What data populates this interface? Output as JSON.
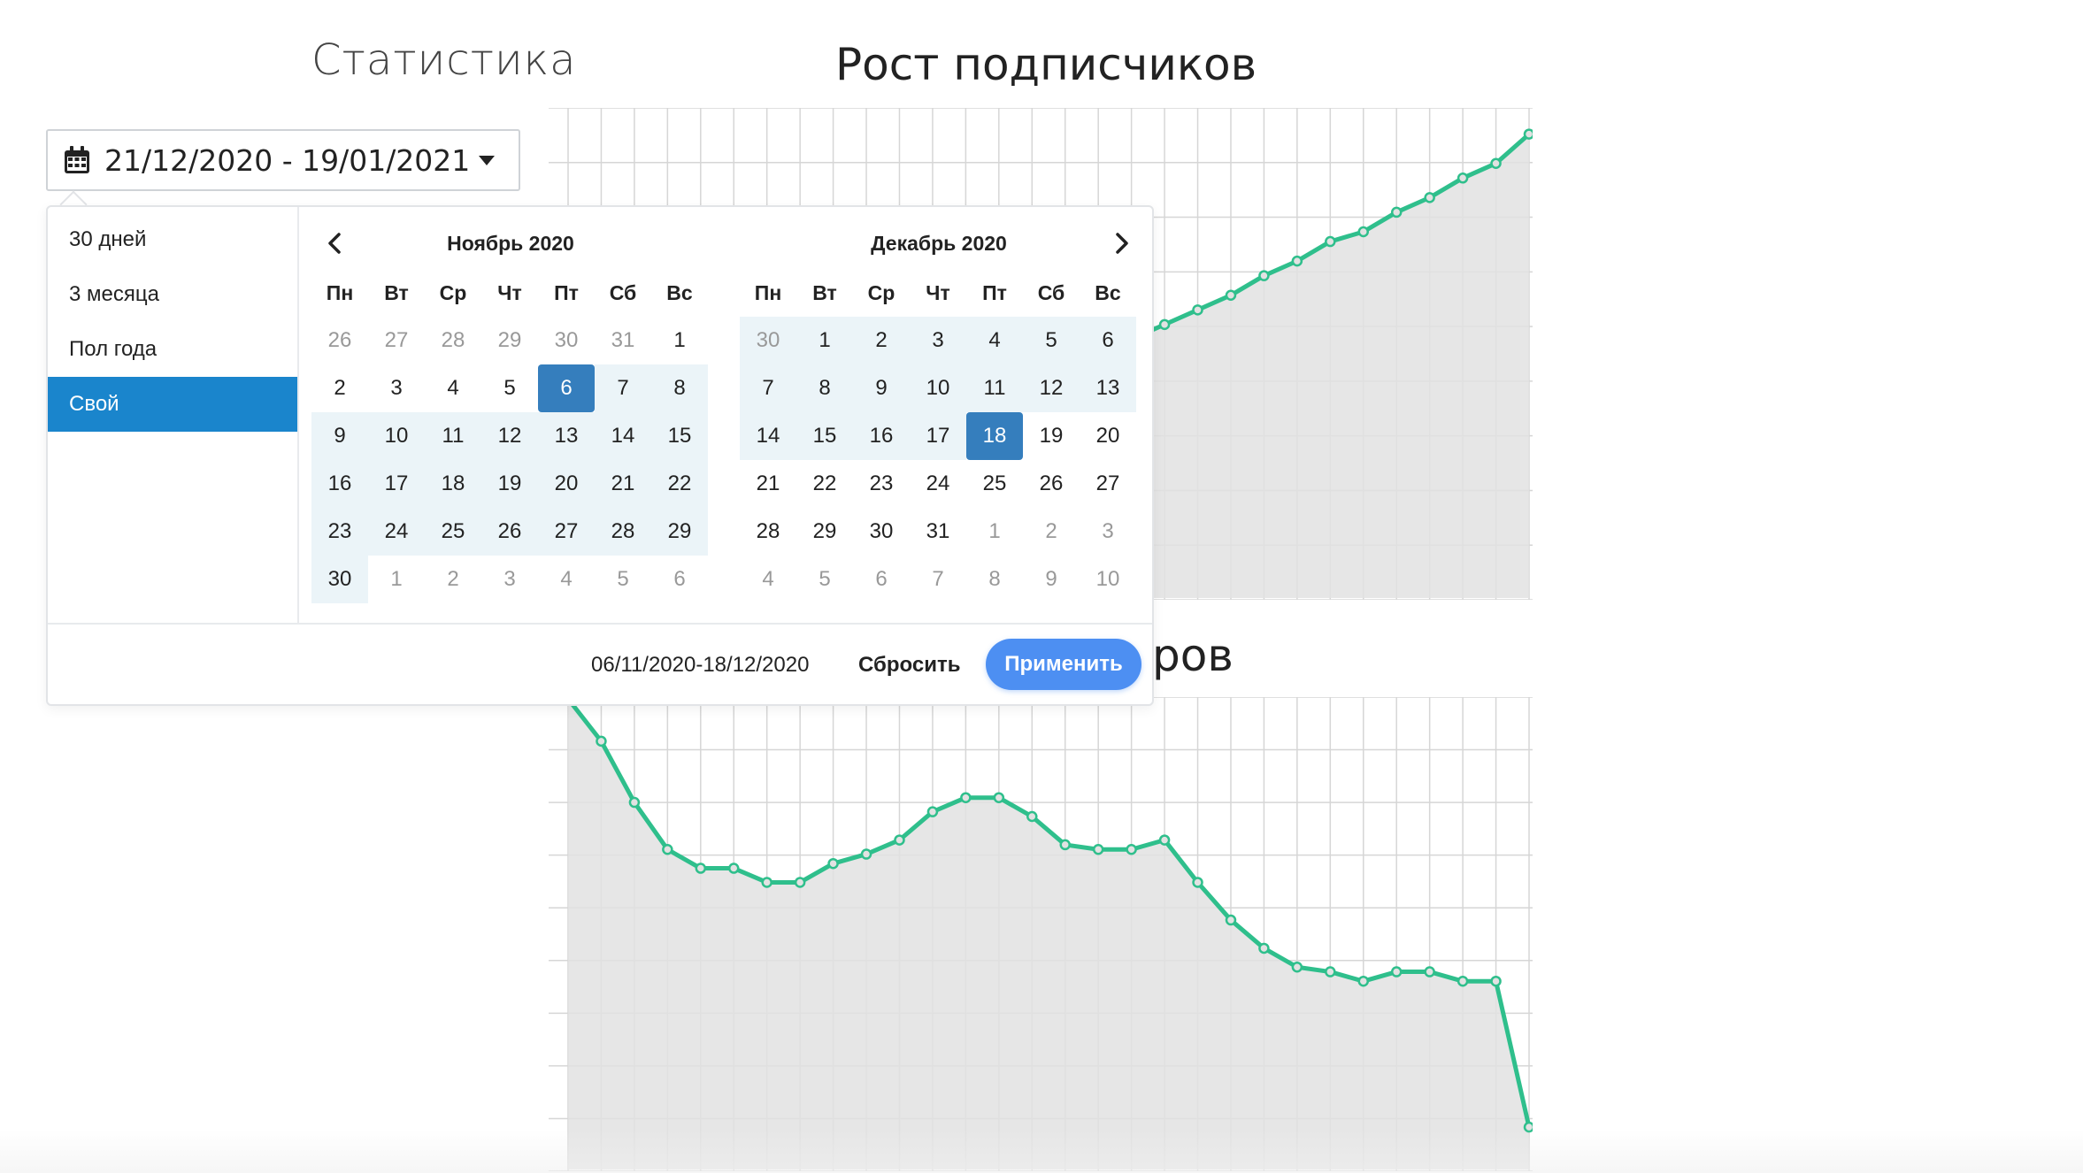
{
  "page": {
    "title": "Статистика"
  },
  "date_button": {
    "label": "21/12/2020 - 19/01/2021",
    "icon": "calendar-icon"
  },
  "charts_titles": {
    "growth": "Рост подписчиков",
    "views_partial": "ров"
  },
  "picker": {
    "ranges": [
      {
        "label": "30 дней",
        "active": false
      },
      {
        "label": "3 месяца",
        "active": false
      },
      {
        "label": "Пол года",
        "active": false
      },
      {
        "label": "Свой",
        "active": true
      }
    ],
    "weekdays": [
      "Пн",
      "Вт",
      "Ср",
      "Чт",
      "Пт",
      "Сб",
      "Вс"
    ],
    "months": [
      {
        "title": "Ноябрь 2020",
        "days": [
          {
            "d": "26",
            "off": true
          },
          {
            "d": "27",
            "off": true
          },
          {
            "d": "28",
            "off": true
          },
          {
            "d": "29",
            "off": true
          },
          {
            "d": "30",
            "off": true
          },
          {
            "d": "31",
            "off": true
          },
          {
            "d": "1"
          },
          {
            "d": "2"
          },
          {
            "d": "3"
          },
          {
            "d": "4"
          },
          {
            "d": "5"
          },
          {
            "d": "6",
            "sel": "start"
          },
          {
            "d": "7",
            "range": true
          },
          {
            "d": "8",
            "range": true
          },
          {
            "d": "9",
            "range": true
          },
          {
            "d": "10",
            "range": true
          },
          {
            "d": "11",
            "range": true
          },
          {
            "d": "12",
            "range": true
          },
          {
            "d": "13",
            "range": true
          },
          {
            "d": "14",
            "range": true
          },
          {
            "d": "15",
            "range": true
          },
          {
            "d": "16",
            "range": true
          },
          {
            "d": "17",
            "range": true
          },
          {
            "d": "18",
            "range": true
          },
          {
            "d": "19",
            "range": true
          },
          {
            "d": "20",
            "range": true
          },
          {
            "d": "21",
            "range": true
          },
          {
            "d": "22",
            "range": true
          },
          {
            "d": "23",
            "range": true
          },
          {
            "d": "24",
            "range": true
          },
          {
            "d": "25",
            "range": true
          },
          {
            "d": "26",
            "range": true
          },
          {
            "d": "27",
            "range": true
          },
          {
            "d": "28",
            "range": true
          },
          {
            "d": "29",
            "range": true
          },
          {
            "d": "30",
            "range": true
          },
          {
            "d": "1",
            "off": true
          },
          {
            "d": "2",
            "off": true
          },
          {
            "d": "3",
            "off": true
          },
          {
            "d": "4",
            "off": true
          },
          {
            "d": "5",
            "off": true
          },
          {
            "d": "6",
            "off": true
          }
        ]
      },
      {
        "title": "Декабрь 2020",
        "days": [
          {
            "d": "30",
            "off": true,
            "range": true
          },
          {
            "d": "1",
            "range": true
          },
          {
            "d": "2",
            "range": true
          },
          {
            "d": "3",
            "range": true
          },
          {
            "d": "4",
            "range": true
          },
          {
            "d": "5",
            "range": true
          },
          {
            "d": "6",
            "range": true
          },
          {
            "d": "7",
            "range": true
          },
          {
            "d": "8",
            "range": true
          },
          {
            "d": "9",
            "range": true
          },
          {
            "d": "10",
            "range": true
          },
          {
            "d": "11",
            "range": true
          },
          {
            "d": "12",
            "range": true
          },
          {
            "d": "13",
            "range": true
          },
          {
            "d": "14",
            "range": true
          },
          {
            "d": "15",
            "range": true
          },
          {
            "d": "16",
            "range": true
          },
          {
            "d": "17",
            "range": true
          },
          {
            "d": "18",
            "sel": "end"
          },
          {
            "d": "19"
          },
          {
            "d": "20"
          },
          {
            "d": "21"
          },
          {
            "d": "22"
          },
          {
            "d": "23"
          },
          {
            "d": "24"
          },
          {
            "d": "25"
          },
          {
            "d": "26"
          },
          {
            "d": "27"
          },
          {
            "d": "28"
          },
          {
            "d": "29"
          },
          {
            "d": "30"
          },
          {
            "d": "31"
          },
          {
            "d": "1",
            "off": true
          },
          {
            "d": "2",
            "off": true
          },
          {
            "d": "3",
            "off": true
          },
          {
            "d": "4",
            "off": true
          },
          {
            "d": "5",
            "off": true
          },
          {
            "d": "6",
            "off": true
          },
          {
            "d": "7",
            "off": true
          },
          {
            "d": "8",
            "off": true
          },
          {
            "d": "9",
            "off": true
          },
          {
            "d": "10",
            "off": true
          }
        ]
      }
    ],
    "selected_text": "06/11/2020-18/12/2020",
    "reset_label": "Сбросить",
    "apply_label": "Применить",
    "nav_prev_icon": "chevron-left-icon",
    "nav_next_icon": "chevron-right-icon"
  },
  "colors": {
    "line": "#2fbf8c",
    "area": "#e2e2e2",
    "grid": "#d6d6d6",
    "accent": "#1a85cc",
    "selected_day": "#357ebd",
    "in_range": "#ebf4f8",
    "apply": "#4d8ff2"
  },
  "chart_data": [
    {
      "type": "area",
      "title": "Рост подписчиков",
      "x": [
        1,
        2,
        3,
        4,
        5,
        6,
        7,
        8,
        9,
        10,
        11,
        12,
        13,
        14,
        15,
        16,
        17,
        18,
        19,
        20,
        21,
        22,
        23,
        24,
        25,
        26,
        27,
        28,
        29,
        30
      ],
      "y": [
        2,
        5,
        8,
        11,
        14,
        17,
        20,
        23,
        26,
        29,
        32,
        35,
        38,
        41,
        44,
        47,
        50,
        53,
        56,
        59,
        62,
        66,
        69,
        73,
        75,
        79,
        82,
        86,
        89,
        95
      ],
      "ylim": [
        0,
        100
      ],
      "grid": true
    },
    {
      "type": "area",
      "title": "",
      "x": [
        1,
        2,
        3,
        4,
        5,
        6,
        7,
        8,
        9,
        10,
        11,
        12,
        13,
        14,
        15,
        16,
        17,
        18,
        19,
        20,
        21,
        22,
        23,
        24,
        25,
        26,
        27,
        28,
        29,
        30
      ],
      "y": [
        100,
        91,
        78,
        68,
        64,
        64,
        61,
        61,
        65,
        67,
        70,
        76,
        79,
        79,
        75,
        69,
        68,
        68,
        70,
        61,
        53,
        47,
        43,
        42,
        40,
        42,
        42,
        40,
        40,
        9
      ],
      "ylim": [
        0,
        100
      ],
      "grid": true
    }
  ]
}
